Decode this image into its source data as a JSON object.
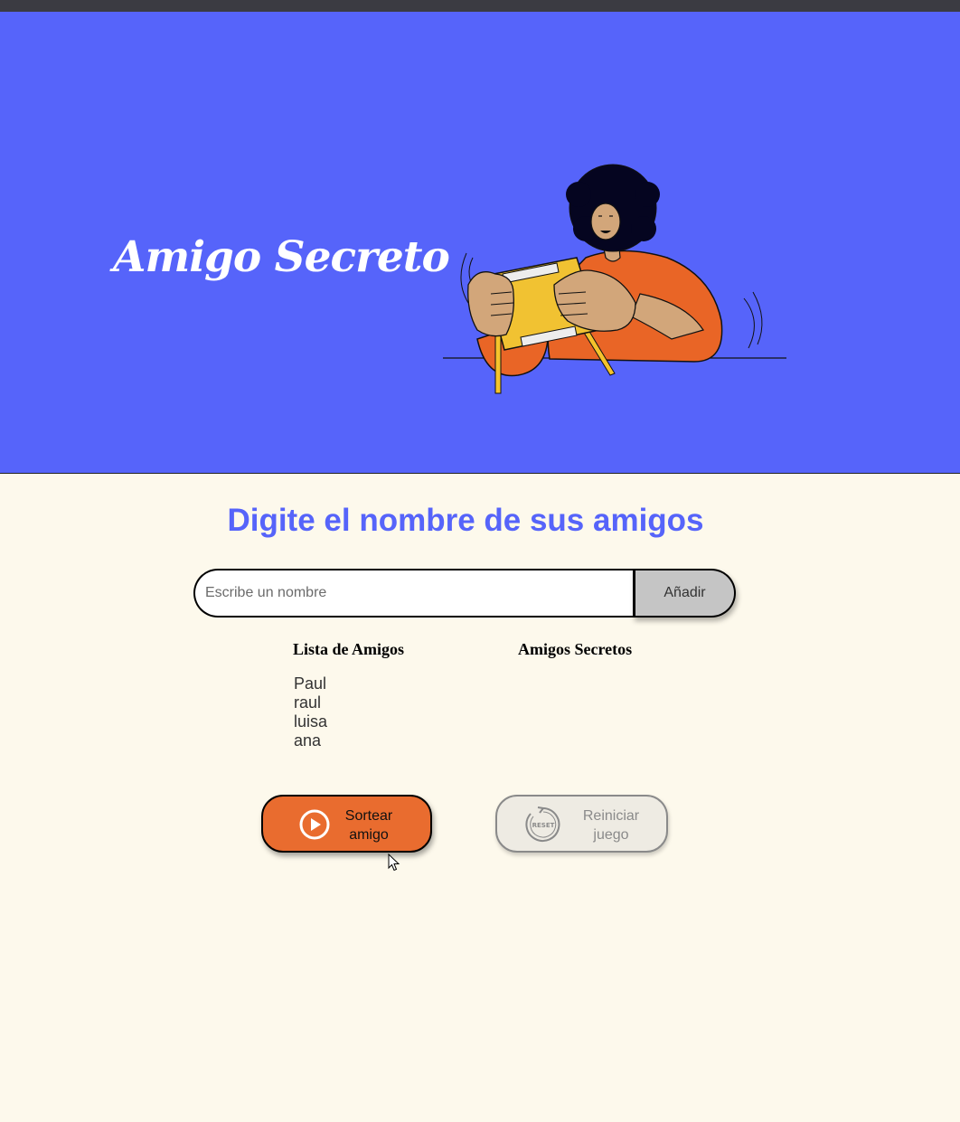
{
  "header": {
    "title": "Amigo Secreto"
  },
  "main": {
    "heading": "Digite el nombre de sus amigos",
    "input": {
      "placeholder": "Escribe un nombre",
      "value": ""
    },
    "add_button": {
      "label": "Añadir"
    },
    "friends_list": {
      "heading": "Lista de Amigos",
      "items": [
        "Paul",
        "raul",
        "luisa",
        "ana"
      ]
    },
    "secret_list": {
      "heading": "Amigos Secretos",
      "items": []
    },
    "draw_button": {
      "label_line1": "Sortear",
      "label_line2": "amigo",
      "icon": "play-circle-icon"
    },
    "reset_button": {
      "label_line1": "Reiniciar",
      "label_line2": "juego",
      "icon": "reset-icon",
      "icon_text": "RESET"
    }
  },
  "colors": {
    "hero_bg": "#5664FA",
    "page_bg": "#FDF9EC",
    "accent_orange": "#E96C2F",
    "button_gray": "#C5C5C5"
  }
}
